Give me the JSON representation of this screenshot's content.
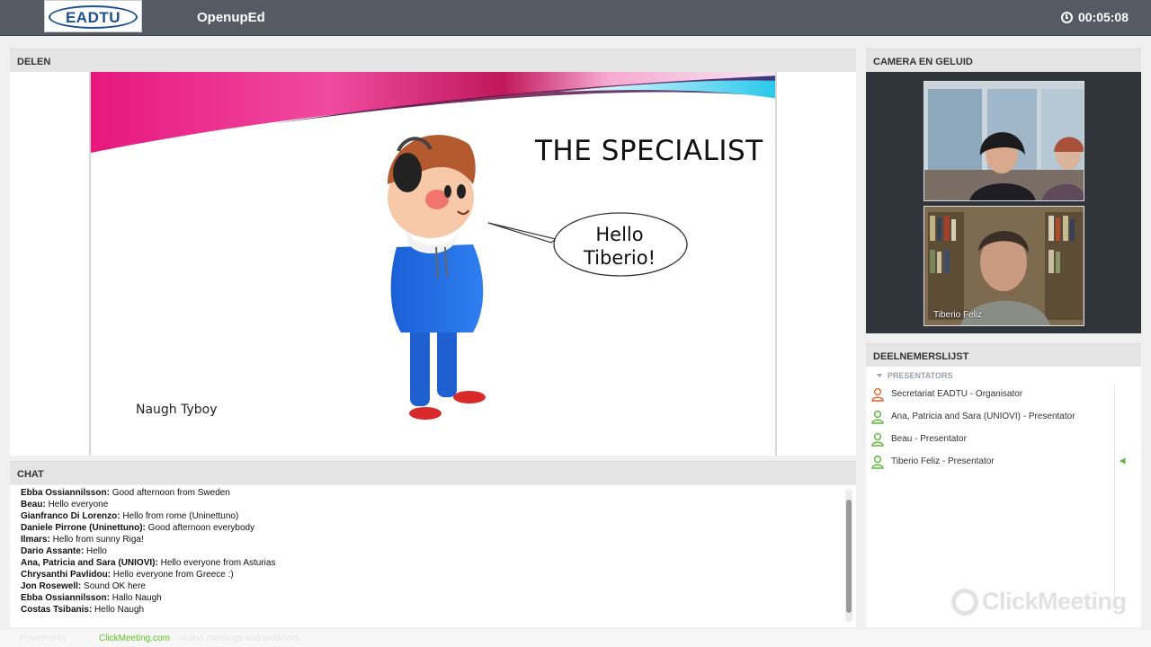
{
  "header": {
    "logo_text": "EADTU",
    "app_title": "OpenupEd",
    "timer": "00:05:08"
  },
  "share_panel": {
    "title": "DELEN",
    "slide": {
      "title": "THE SPECIALIST",
      "bubble_line1": "Hello",
      "bubble_line2": "Tiberio!",
      "caption": "Naugh Tyboy"
    }
  },
  "camera_panel": {
    "title": "CAMERA EN GELUID",
    "videos": [
      {
        "name": ""
      },
      {
        "name": "Tiberio Feliz"
      }
    ]
  },
  "participants_panel": {
    "title": "DEELNEMERSLIJST",
    "section": "PRESENTATORS",
    "items": [
      {
        "label": "Secretariat EADTU  - Organisator",
        "color": "#e2622c"
      },
      {
        "label": "Ana, Patricia and Sara (UNIOVI)  - Presentator",
        "color": "#5cb83a"
      },
      {
        "label": "Beau  - Presentator",
        "color": "#5cb83a"
      },
      {
        "label": "Tiberio Feliz  - Presentator",
        "color": "#5cb83a"
      }
    ],
    "watermark": "ClickMeeting"
  },
  "chat_panel": {
    "title": "CHAT",
    "messages": [
      {
        "author": "Ebba Ossiannilsson:",
        "text": " Good afternoon from Sweden"
      },
      {
        "author": "Beau:",
        "text": " Hello everyone"
      },
      {
        "author": "Gianfranco Di Lorenzo:",
        "text": " Hello from rome (Uninettuno)"
      },
      {
        "author": "Daniele Pirrone (Uninettuno):",
        "text": " Good afternoon everybody"
      },
      {
        "author": "Ilmars:",
        "text": " Hello from sunny Riga!"
      },
      {
        "author": "Dario Assante:",
        "text": " Hello"
      },
      {
        "author": "Ana, Patricia and Sara (UNIOVI):",
        "text": " Hello everyone from Asturias"
      },
      {
        "author": "Chrysanthi Pavlidou:",
        "text": " Hello everyone from Greece :)"
      },
      {
        "author": "Jon Rosewell:",
        "text": " Sound OK here"
      },
      {
        "author": "Ebba Ossiannilsson:",
        "text": " Hallo Naugh"
      },
      {
        "author": "Costas Tsibanis:",
        "text": " Hello Naugh"
      }
    ]
  },
  "footer": {
    "left": "Powered by",
    "link": "ClickMeeting.com",
    "right": "online meetings and webinars"
  },
  "colors": {
    "topbar": "#545b63",
    "accent_green": "#5cc21f",
    "organizer_orange": "#e2622c",
    "presenter_green": "#5cb83a"
  }
}
